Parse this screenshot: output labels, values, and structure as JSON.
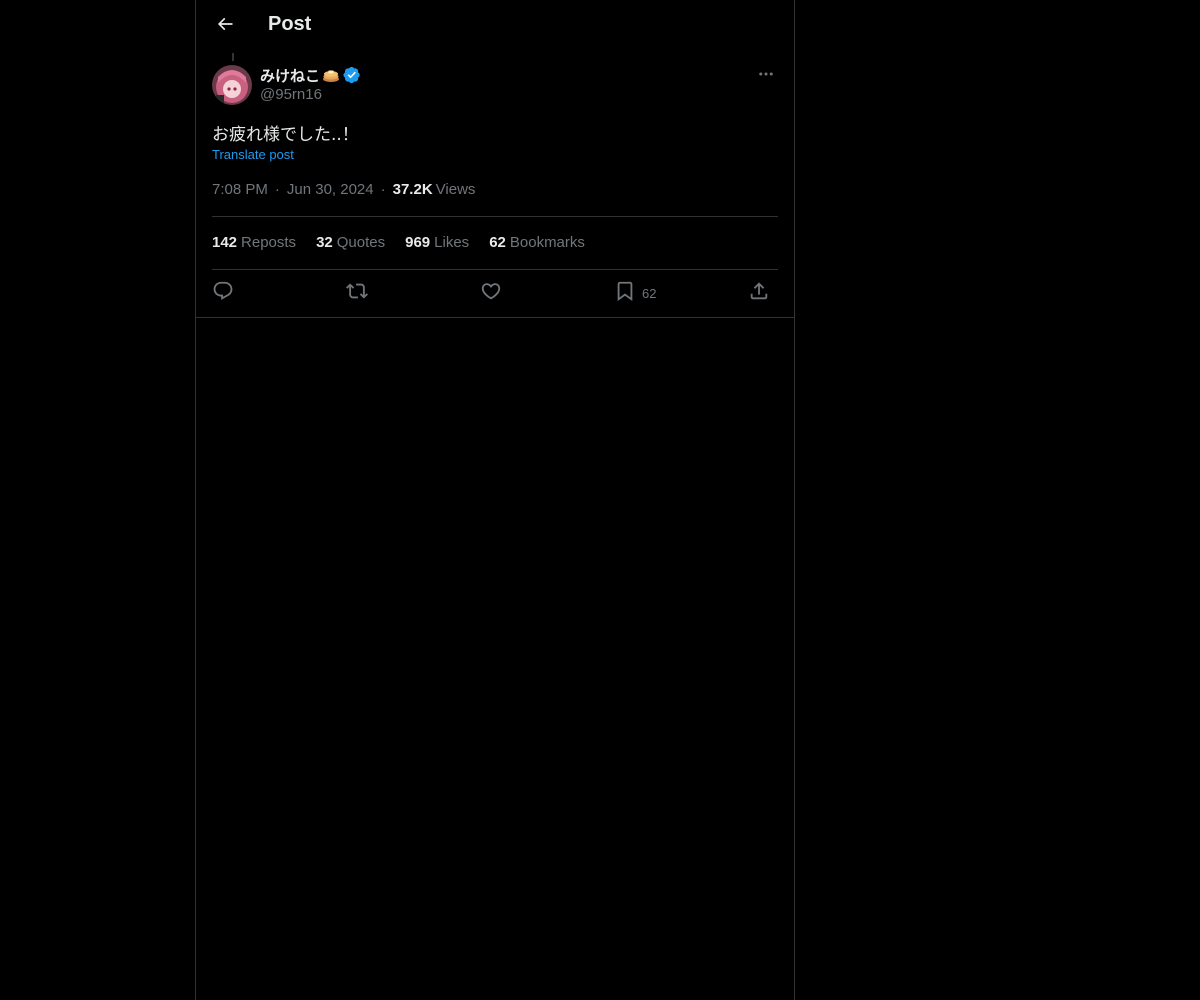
{
  "header": {
    "title": "Post",
    "back_icon": "arrow-left-icon"
  },
  "post": {
    "author": {
      "display_name": "みけねこ",
      "name_emoji": "pancake-emoji-icon",
      "verified_icon": "verified-badge-icon",
      "handle": "@95rn16"
    },
    "text": "お疲れ様でした..！",
    "translate_label": "Translate post",
    "time": "7:08 PM",
    "date": "Jun 30, 2024",
    "separator": "·",
    "views_count": "37.2K",
    "views_label": "Views"
  },
  "stats": [
    {
      "count": "142",
      "label": "Reposts"
    },
    {
      "count": "32",
      "label": "Quotes"
    },
    {
      "count": "969",
      "label": "Likes"
    },
    {
      "count": "62",
      "label": "Bookmarks"
    }
  ],
  "actions": {
    "reply_icon": "reply-icon",
    "repost_icon": "repost-icon",
    "like_icon": "heart-icon",
    "bookmark_icon": "bookmark-icon",
    "bookmark_count": "62",
    "share_icon": "share-icon"
  },
  "colors": {
    "background": "#000000",
    "text": "#e7e9ea",
    "muted": "#71767b",
    "accent": "#1d9bf0",
    "border": "#2f3336"
  }
}
